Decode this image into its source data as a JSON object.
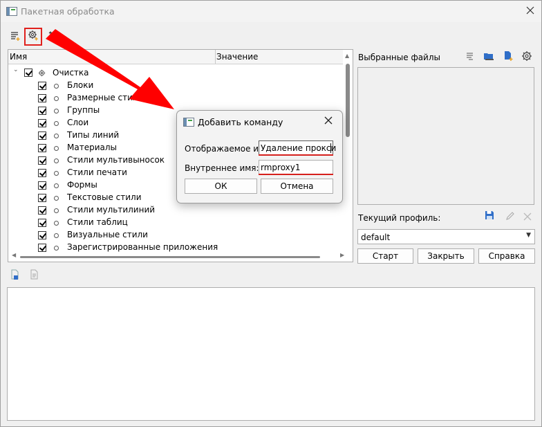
{
  "window": {
    "title": "Пакетная обработка"
  },
  "toolbar": {
    "icons": [
      "add-command-list-icon",
      "add-settings-command-icon",
      "sort-icon"
    ]
  },
  "tree": {
    "columns": {
      "name": "Имя",
      "value": "Значение"
    },
    "root": {
      "label": "Очистка",
      "checked": true,
      "expanded": true
    },
    "items": [
      {
        "label": "Блоки",
        "checked": true
      },
      {
        "label": "Размерные стили",
        "checked": true
      },
      {
        "label": "Группы",
        "checked": true
      },
      {
        "label": "Слои",
        "checked": true
      },
      {
        "label": "Типы линий",
        "checked": true
      },
      {
        "label": "Материалы",
        "checked": true
      },
      {
        "label": "Стили мультивыносок",
        "checked": true
      },
      {
        "label": "Стили печати",
        "checked": true
      },
      {
        "label": "Формы",
        "checked": true
      },
      {
        "label": "Текстовые стили",
        "checked": true
      },
      {
        "label": "Стили мультилиний",
        "checked": true
      },
      {
        "label": "Стили таблиц",
        "checked": true
      },
      {
        "label": "Визуальные стили",
        "checked": true
      },
      {
        "label": "Зарегистрированные приложения",
        "checked": true
      }
    ]
  },
  "files": {
    "label": "Выбранные файлы"
  },
  "profile": {
    "label": "Текущий профиль:",
    "selected": "default",
    "buttons": {
      "start": "Старт",
      "close": "Закрыть",
      "help": "Справка"
    }
  },
  "dialog": {
    "title": "Добавить команду",
    "display_name_label": "Отображаемое имя:",
    "display_name_value": "Удаление прокси",
    "internal_name_label": "Внутреннее имя:",
    "internal_name_value": "rmproxy1",
    "ok": "ОК",
    "cancel": "Отмена"
  },
  "colors": {
    "highlight": "#e0201c",
    "arrow": "#ff0000",
    "accent_blue": "#2f6ec8"
  }
}
